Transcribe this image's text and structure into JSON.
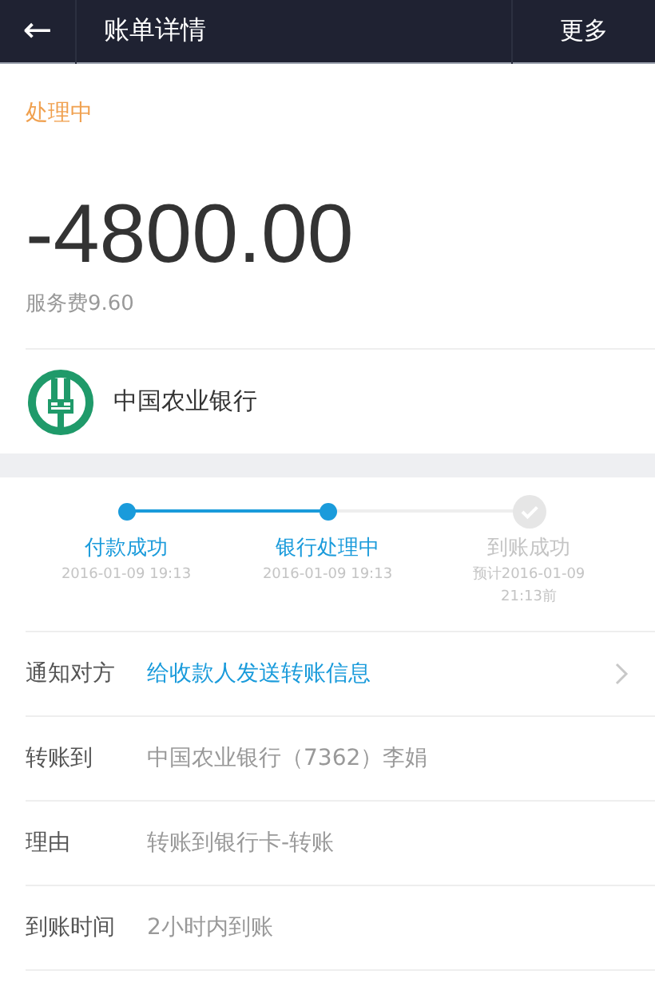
{
  "header": {
    "back_icon": "←",
    "title": "账单详情",
    "action": "更多"
  },
  "summary": {
    "status": "处理中",
    "amount": "-4800.00",
    "fee": "服务费9.60",
    "bank": "中国农业银行"
  },
  "steps": [
    {
      "label": "付款成功",
      "time": "2016-01-09 19:13",
      "completed": true
    },
    {
      "label": "银行处理中",
      "time": "2016-01-09 19:13",
      "completed": true
    },
    {
      "label": "到账成功",
      "time": "预计2016-01-09 21:13前",
      "completed": false
    }
  ],
  "rows": [
    {
      "kind": "link",
      "label": "通知对方",
      "value": "给收款人发送转账信息"
    },
    {
      "kind": "plain",
      "label": "转账到",
      "value": "中国农业银行（7362）李娟"
    },
    {
      "kind": "plain",
      "label": "理由",
      "value": "转账到银行卡-转账"
    },
    {
      "kind": "plain",
      "label": "到账时间",
      "value": "2小时内到账"
    }
  ]
}
